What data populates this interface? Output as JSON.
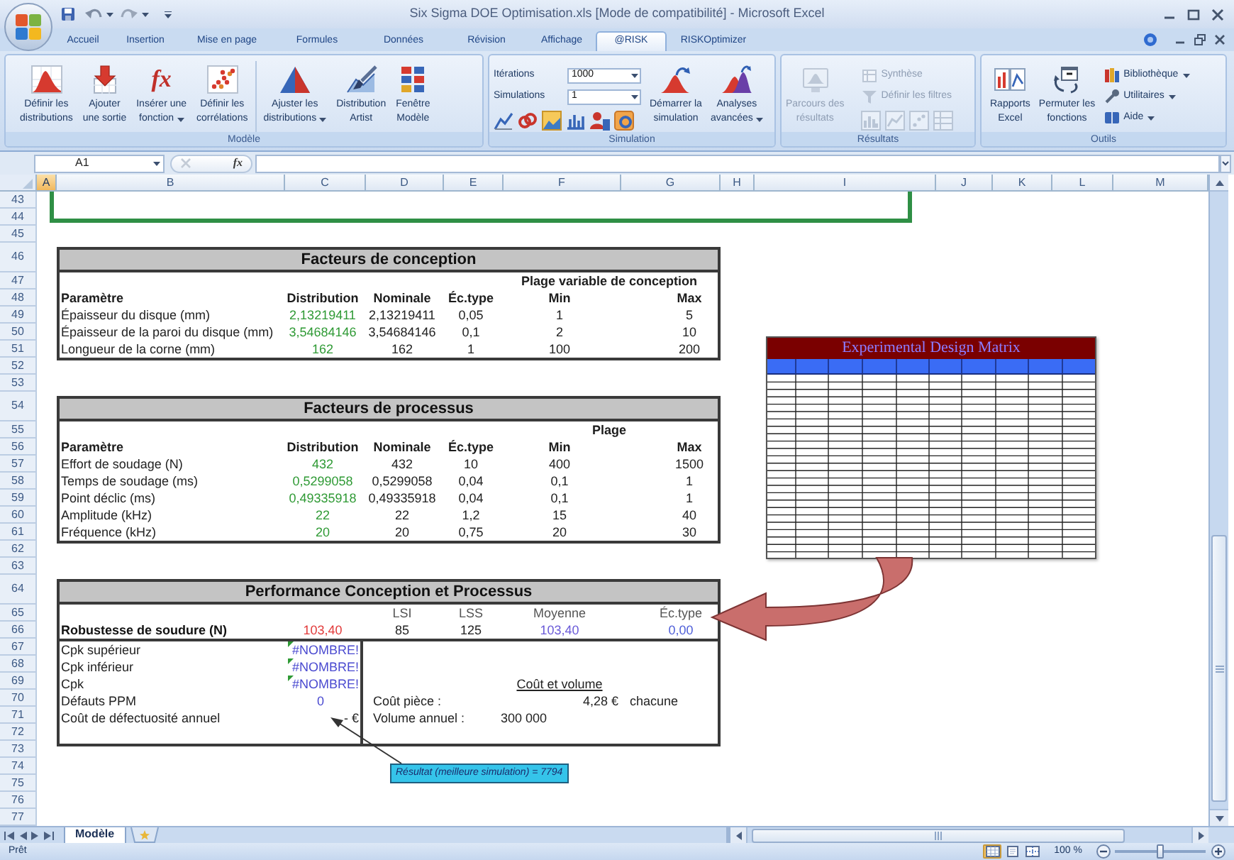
{
  "window": {
    "title": "Six Sigma DOE Optimisation.xls [Mode de compatibilité] - Microsoft Excel"
  },
  "ribbon_tabs": [
    {
      "label": "Accueil",
      "selected": false
    },
    {
      "label": "Insertion",
      "selected": false
    },
    {
      "label": "Mise en page",
      "selected": false
    },
    {
      "label": "Formules",
      "selected": false
    },
    {
      "label": "Données",
      "selected": false
    },
    {
      "label": "Révision",
      "selected": false
    },
    {
      "label": "Affichage",
      "selected": false
    },
    {
      "label": "@RISK",
      "selected": true
    },
    {
      "label": "RISKOptimizer",
      "selected": false
    }
  ],
  "ribbon_groups": [
    {
      "label": "Modèle",
      "disabled": false,
      "items": [
        {
          "kind": "large",
          "lines": [
            "Définir les",
            "distributions"
          ],
          "dropdown": false
        },
        {
          "kind": "large",
          "lines": [
            "Ajouter",
            "une sortie"
          ],
          "dropdown": false
        },
        {
          "kind": "large",
          "glyph": "fx",
          "lines": [
            "Insérer une",
            "fonction"
          ],
          "dropdown": true
        },
        {
          "kind": "large",
          "lines": [
            "Définir les",
            "corrélations"
          ],
          "dropdown": false
        },
        {
          "kind": "separator"
        },
        {
          "kind": "large",
          "lines": [
            "Ajuster les",
            "distributions"
          ],
          "dropdown": true
        },
        {
          "kind": "large",
          "lines": [
            "Distribution",
            "Artist"
          ],
          "dropdown": false
        },
        {
          "kind": "large",
          "lines": [
            "Fenêtre",
            "Modèle"
          ],
          "dropdown": false
        }
      ]
    },
    {
      "label": "Simulation",
      "disabled": false,
      "items": [
        {
          "kind": "stack",
          "rows": [
            {
              "kind": "field",
              "label": "Itérations",
              "value": "1000"
            },
            {
              "kind": "field",
              "label": "Simulations",
              "value": "1"
            },
            {
              "kind": "icons"
            }
          ]
        },
        {
          "kind": "large",
          "lines": [
            "Démarrer la",
            "simulation"
          ],
          "dropdown": false
        },
        {
          "kind": "large",
          "lines": [
            "Analyses",
            "avancées"
          ],
          "dropdown": true
        }
      ]
    },
    {
      "label": "Résultats",
      "disabled": true,
      "items": [
        {
          "kind": "large",
          "lines": [
            "Parcours des",
            "résultats"
          ],
          "dropdown": false
        },
        {
          "kind": "stack",
          "rows": [
            {
              "kind": "small",
              "label": "Synthèse",
              "dropdown": false
            },
            {
              "kind": "small",
              "label": "Définir les filtres",
              "dropdown": false
            },
            {
              "kind": "icons"
            }
          ]
        }
      ]
    },
    {
      "label": "Outils",
      "disabled": false,
      "items": [
        {
          "kind": "large",
          "lines": [
            "Rapports",
            "Excel"
          ],
          "dropdown": false
        },
        {
          "kind": "large",
          "lines": [
            "Permuter les",
            "fonctions"
          ],
          "dropdown": false
        },
        {
          "kind": "stack",
          "rows": [
            {
              "kind": "small",
              "label": "Bibliothèque",
              "dropdown": true
            },
            {
              "kind": "small",
              "label": "Utilitaires",
              "dropdown": true
            },
            {
              "kind": "small",
              "label": "Aide",
              "dropdown": true
            }
          ]
        }
      ]
    }
  ],
  "formula_bar": {
    "name_box": "A1",
    "function_glyph": "fx"
  },
  "columns": [
    {
      "label": "A",
      "selected": true
    },
    {
      "label": "B",
      "selected": false
    },
    {
      "label": "C",
      "selected": false
    },
    {
      "label": "D",
      "selected": false
    },
    {
      "label": "E",
      "selected": false
    },
    {
      "label": "F",
      "selected": false
    },
    {
      "label": "G",
      "selected": false
    },
    {
      "label": "H",
      "selected": false
    },
    {
      "label": "I",
      "selected": false
    },
    {
      "label": "J",
      "selected": false
    },
    {
      "label": "K",
      "selected": false
    },
    {
      "label": "L",
      "selected": false
    },
    {
      "label": "M",
      "selected": false
    }
  ],
  "rows": [
    "43",
    "44",
    "45",
    "46",
    "47",
    "48",
    "49",
    "50",
    "51",
    "52",
    "53",
    "54",
    "55",
    "56",
    "57",
    "58",
    "59",
    "60",
    "61",
    "62",
    "63",
    "64",
    "65",
    "66",
    "67",
    "68",
    "69",
    "70",
    "71",
    "72",
    "73",
    "74",
    "75",
    "76",
    "77"
  ],
  "design_table": {
    "title": "Facteurs de conception",
    "group_heading": "Plage variable de conception",
    "headers": [
      "Paramètre",
      "Distribution",
      "Nominale",
      "Éc.type",
      "Min",
      "Max"
    ],
    "rows": [
      [
        "Épaisseur du disque (mm)",
        "2,13219411",
        "2,13219411",
        "0,05",
        "1",
        "5"
      ],
      [
        "Épaisseur de la paroi du disque (mm)",
        "3,54684146",
        "3,54684146",
        "0,1",
        "2",
        "10"
      ],
      [
        "Longueur de la corne (mm)",
        "162",
        "162",
        "1",
        "100",
        "200"
      ]
    ]
  },
  "process_table": {
    "title": "Facteurs de processus",
    "group_heading": "Plage",
    "headers": [
      "Paramètre",
      "Distribution",
      "Nominale",
      "Éc.type",
      "Min",
      "Max"
    ],
    "rows": [
      [
        "Effort de soudage (N)",
        "432",
        "432",
        "10",
        "400",
        "1500"
      ],
      [
        "Temps de soudage (ms)",
        "0,5299058",
        "0,5299058",
        "0,04",
        "0,1",
        "1"
      ],
      [
        "Point déclic (ms)",
        "0,49335918",
        "0,49335918",
        "0,04",
        "0,1",
        "1"
      ],
      [
        "Amplitude (kHz)",
        "22",
        "22",
        "1,2",
        "15",
        "40"
      ],
      [
        "Fréquence (kHz)",
        "20",
        "20",
        "0,75",
        "20",
        "30"
      ]
    ]
  },
  "performance_table": {
    "title": "Performance Conception et Processus",
    "headers": [
      "LSI",
      "LSS",
      "Moyenne",
      "Éc.type"
    ],
    "main_row": {
      "label": "Robustesse de soudure (N)",
      "values": [
        "103,40",
        "85",
        "125",
        "103,40",
        "0,00"
      ]
    },
    "metrics": [
      {
        "kind": "error",
        "label": "Cpk supérieur",
        "value": "#NOMBRE!"
      },
      {
        "kind": "error",
        "label": "Cpk inférieur",
        "value": "#NOMBRE!"
      },
      {
        "kind": "error",
        "label": "Cpk",
        "value": "#NOMBRE!"
      },
      {
        "kind": "number",
        "label": "Défauts PPM",
        "value": "0"
      },
      {
        "kind": "currency",
        "label": "Coût de défectuosité annuel",
        "value": "- €"
      }
    ],
    "cost_section": {
      "title": "Coût et volume",
      "rows": [
        {
          "label": "Coût pièce :",
          "value": "4,28 €",
          "unit": "chacune"
        },
        {
          "label": "Volume annuel :",
          "value": "300 000"
        }
      ]
    }
  },
  "matrix": {
    "title": "Experimental Design Matrix"
  },
  "callout": {
    "text": "Résultat (meilleure simulation) = 7794"
  },
  "sheet_tabs": [
    {
      "label": "Modèle",
      "selected": true
    }
  ],
  "status_bar": {
    "text": "Prêt",
    "views": [
      {
        "selected": true
      },
      {
        "selected": false
      },
      {
        "selected": false
      }
    ],
    "zoom": "100 %",
    "zoom_slider": {
      "level": 0.5
    }
  }
}
